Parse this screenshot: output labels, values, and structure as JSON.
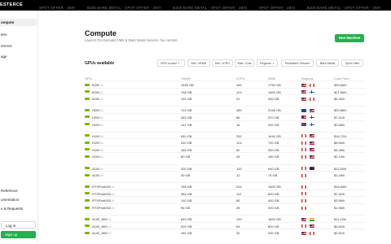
{
  "brand": "ESTERCE",
  "promos": [
    "SPOT OFFER - 28/H",
    "B200 BARE METAL - SPOT OFFER - 28/H",
    "B200 BARE METAL - SPOT OFFER - 28/H",
    "SPOT OFFER - 28/H",
    "B200 BARE METAL - SPOT OFFER - 28/H"
  ],
  "sidebar": {
    "items": [
      {
        "label": "ompute",
        "active": true
      },
      {
        "label": "ters",
        "active": false
      },
      {
        "label": "erence",
        "active": false
      },
      {
        "label": "age",
        "active": false
      }
    ],
    "bottom_items": [
      {
        "label": "Reference"
      },
      {
        "label": "umentation"
      },
      {
        "label": "e & Requests"
      }
    ],
    "login_label": "Log in",
    "signup_label": "Sign up"
  },
  "main": {
    "title": "Compute",
    "subtitle": "Launch On-Demand VMs & Bare Metal Servers. No commit.",
    "new_machine_label": "New Machine",
    "gpus_heading": "GPUs available",
    "filters": [
      "GPU model",
      "Min. vRAM",
      "Min. vCPU",
      "Max. Cost",
      "Regions",
      "Persistent Volume",
      "Bare-Metal",
      "Spot Offer"
    ],
    "columns": [
      "GPU",
      "VRAM",
      "vCPU",
      "RAM",
      "Regions",
      "Cost From"
    ]
  },
  "accent": "#22b14c",
  "gpu_icon_color": "#76b900",
  "rows": [
    {
      "gpu": "B200",
      "badge": "x1",
      "vram": "1536 GB",
      "vcpu": "160",
      "ram": "1790 GB",
      "flags": [
        "us",
        "ca"
      ],
      "cost": "$39.60/h"
    },
    {
      "gpu": "B200",
      "badge": "x1",
      "vram": "768 GB",
      "vcpu": "124",
      "ram": "1600 GB",
      "flags": [
        "us",
        "fi"
      ],
      "cost": "$21.56/h"
    },
    {
      "gpu": "B200",
      "badge": "x1",
      "vram": "192 GB",
      "vcpu": "31",
      "ram": "250 GB",
      "flags": [
        "us",
        "ca"
      ],
      "cost": "$5.40/h"
    },
    {
      "gpu": "H200",
      "badge": "x1",
      "vram": "720 GB",
      "vcpu": "480",
      "ram": "2048 GB",
      "flags": [
        "eu",
        "us"
      ],
      "cost": "$20.68/h"
    },
    {
      "gpu": "H200",
      "badge": "x1",
      "vram": "282 GB",
      "vcpu": "88",
      "ram": "370 GB",
      "flags": [
        "us",
        "fi"
      ],
      "cost": "$7.41/h"
    },
    {
      "gpu": "H200",
      "badge": "x1",
      "vram": "141 GB",
      "vcpu": "16",
      "ram": "200 GB",
      "flags": [
        "is",
        "fi"
      ],
      "cost": "$2.68/h"
    },
    {
      "gpu": "H100",
      "badge": "x1",
      "vram": "640 GB",
      "vcpu": "252",
      "ram": "1440 GB",
      "flags": [
        "ca",
        "us"
      ],
      "cost": "$16.72/h"
    },
    {
      "gpu": "H100",
      "badge": "x1",
      "vram": "320 GB",
      "vcpu": "124",
      "ram": "720 GB",
      "flags": [
        "ca",
        "us"
      ],
      "cost": "$8.56/h"
    },
    {
      "gpu": "H100",
      "badge": "x1",
      "vram": "160 GB",
      "vcpu": "60",
      "ram": "360 GB",
      "flags": [
        "ca",
        "us"
      ],
      "cost": "$4.28/h"
    },
    {
      "gpu": "H100",
      "badge": "x1",
      "vram": "80 GB",
      "vcpu": "28",
      "ram": "180 GB",
      "flags": [
        "ca",
        "us"
      ],
      "cost": "$2.14/h"
    },
    {
      "gpu": "A100",
      "badge": "x1",
      "vram": "320 GB",
      "vcpu": "120",
      "ram": "940 GB",
      "flags": [
        "ca",
        "no"
      ],
      "cost": "$11.60/h"
    },
    {
      "gpu": "A100",
      "badge": "x1",
      "vram": "40 GB",
      "vcpu": "12",
      "ram": "74 GB",
      "flags": [
        "ca"
      ],
      "cost": "$1.28/h"
    },
    {
      "gpu": "RTXPro6000",
      "badge": "x1",
      "vram": "768 GB",
      "vcpu": "224",
      "ram": "1600 GB",
      "flags": [
        "ca"
      ],
      "cost": "$15.84/h"
    },
    {
      "gpu": "RTXPro6000",
      "badge": "x1",
      "vram": "384 GB",
      "vcpu": "112",
      "ram": "800 GB",
      "flags": [
        "ca"
      ],
      "cost": "$7.92/h"
    },
    {
      "gpu": "RTXPro6000",
      "badge": "x1",
      "vram": "192 GB",
      "vcpu": "56",
      "ram": "400 GB",
      "flags": [
        "ca"
      ],
      "cost": "$3.96/h"
    },
    {
      "gpu": "RTXPro6000",
      "badge": "x1",
      "vram": "96 GB",
      "vcpu": "28",
      "ram": "200 GB",
      "flags": [
        "ca"
      ],
      "cost": "$1.98/h"
    },
    {
      "gpu": "A100_80G",
      "badge": "x1",
      "vram": "640 GB",
      "vcpu": "120",
      "ram": "1600 GB",
      "flags": [
        "us",
        "in"
      ],
      "cost": "$11.24/h"
    },
    {
      "gpu": "A100_80G",
      "badge": "x1",
      "vram": "320 GB",
      "vcpu": "64",
      "ram": "800 GB",
      "flags": [
        "ca",
        "us"
      ],
      "cost": "$5.62/h"
    },
    {
      "gpu": "A100_80G",
      "badge": "x1",
      "vram": "160 GB",
      "vcpu": "32",
      "ram": "400 GB",
      "flags": [
        "us",
        "ca"
      ],
      "cost": "$2.81/h"
    }
  ]
}
